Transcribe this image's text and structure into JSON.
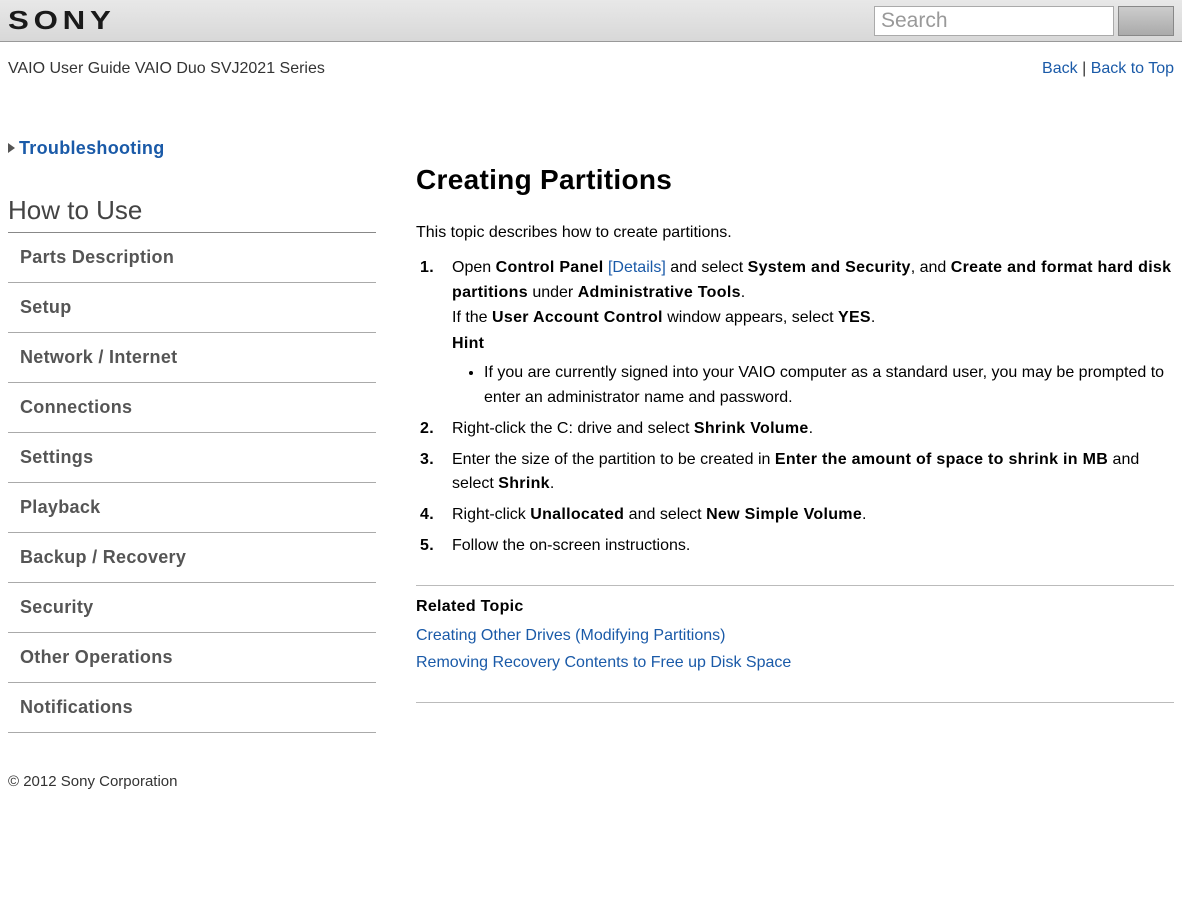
{
  "header": {
    "logo_text": "SONY",
    "search_placeholder": "Search"
  },
  "subheader": {
    "title": "VAIO User Guide VAIO Duo SVJ2021 Series",
    "back": "Back",
    "back_to_top": "Back to Top"
  },
  "sidebar": {
    "troubleshooting": "Troubleshooting",
    "how_to_use": "How to Use",
    "items": [
      {
        "label": "Parts Description"
      },
      {
        "label": "Setup"
      },
      {
        "label": "Network / Internet"
      },
      {
        "label": "Connections"
      },
      {
        "label": "Settings"
      },
      {
        "label": "Playback"
      },
      {
        "label": "Backup / Recovery"
      },
      {
        "label": "Security"
      },
      {
        "label": "Other Operations"
      },
      {
        "label": "Notifications"
      }
    ]
  },
  "main": {
    "title": "Creating Partitions",
    "intro": "This topic describes how to create partitions.",
    "step1": {
      "pre": "Open ",
      "b1": "Control Panel",
      "details": " [Details]",
      "mid1": " and select ",
      "b2": "System and Security",
      "mid2": ", and ",
      "b3": "Create and format hard disk partitions",
      "mid3": " under ",
      "b4": "Administrative Tools",
      "end1": ".",
      "line2a": "If the ",
      "b5": "User Account Control",
      "line2b": " window appears, select ",
      "b6": "YES",
      "line2c": ".",
      "hint": "Hint",
      "bullet": "If you are currently signed into your VAIO computer as a standard user, you may be prompted to enter an administrator name and password."
    },
    "step2": {
      "pre": "Right-click the C: drive and select ",
      "b1": "Shrink Volume",
      "end": "."
    },
    "step3": {
      "pre": "Enter the size of the partition to be created in ",
      "b1": "Enter the amount of space to shrink in MB",
      "mid": " and select ",
      "b2": "Shrink",
      "end": "."
    },
    "step4": {
      "pre": "Right-click ",
      "b1": "Unallocated",
      "mid": " and select ",
      "b2": "New Simple Volume",
      "end": "."
    },
    "step5": "Follow the on-screen instructions.",
    "related_label": "Related Topic",
    "related": [
      "Creating Other Drives (Modifying Partitions)",
      "Removing Recovery Contents to Free up Disk Space"
    ]
  },
  "footer": "© 2012 Sony Corporation"
}
